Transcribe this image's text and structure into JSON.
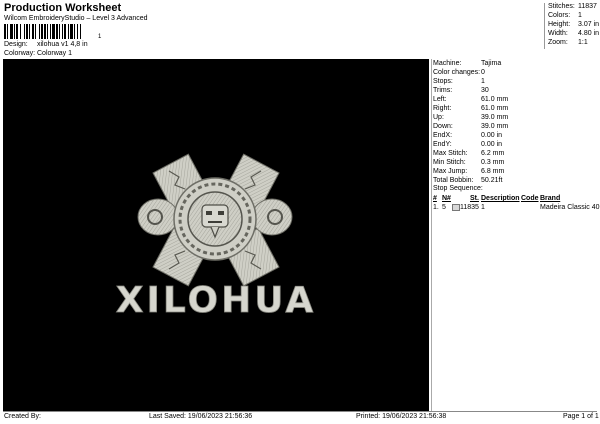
{
  "header": {
    "title": "Production Worksheet",
    "subtitle": "Wilcom EmbroideryStudio – Level 3 Advanced",
    "barcode_number": "1"
  },
  "design": {
    "label": "Design:",
    "value": "xilohua v1 4,8 in"
  },
  "colorway": {
    "label": "Colorway:",
    "value": "Colorway 1"
  },
  "stats": [
    {
      "label": "Stitches:",
      "value": "11837"
    },
    {
      "label": "Colors:",
      "value": "1"
    },
    {
      "label": "Height:",
      "value": "3.07 in"
    },
    {
      "label": "Width:",
      "value": "4.80 in"
    },
    {
      "label": "Zoom:",
      "value": "1:1"
    }
  ],
  "canvas": {
    "wordmark": "XILOHUA",
    "thread_color": "#d8d8d0",
    "background": "#000000"
  },
  "info": [
    {
      "label": "Machine:",
      "value": "Tajima"
    },
    {
      "label": "Color changes:",
      "value": "0"
    },
    {
      "label": "Stops:",
      "value": "1"
    },
    {
      "label": "Trims:",
      "value": "30"
    },
    {
      "label": "Left:",
      "value": "61.0 mm"
    },
    {
      "label": "Right:",
      "value": "61.0 mm"
    },
    {
      "label": "Up:",
      "value": "39.0 mm"
    },
    {
      "label": "Down:",
      "value": "39.0 mm"
    },
    {
      "label": "EndX:",
      "value": "0.00 in"
    },
    {
      "label": "EndY:",
      "value": "0.00 in"
    },
    {
      "label": "Max Stitch:",
      "value": "6.2 mm"
    },
    {
      "label": "Min Stitch:",
      "value": "0.3 mm"
    },
    {
      "label": "Max Jump:",
      "value": "6.8 mm"
    },
    {
      "label": "Total Bobbin:",
      "value": "50.21ft"
    }
  ],
  "stop_sequence": {
    "title": "Stop Sequence:",
    "headers": [
      "#",
      "N#",
      "St.",
      "Description",
      "Code",
      "Brand"
    ],
    "rows": [
      {
        "num": "1.",
        "n": "5",
        "swatch": "#d8d8d8",
        "stitches": "11835",
        "description": "1",
        "code": "",
        "brand": "Madeira Classic 40"
      }
    ]
  },
  "footer": {
    "created_by": "Created By:",
    "last_saved": "Last Saved: 19/06/2023 21:56:36",
    "printed": "Printed: 19/06/2023 21:56:38",
    "page": "Page 1 of 1"
  }
}
